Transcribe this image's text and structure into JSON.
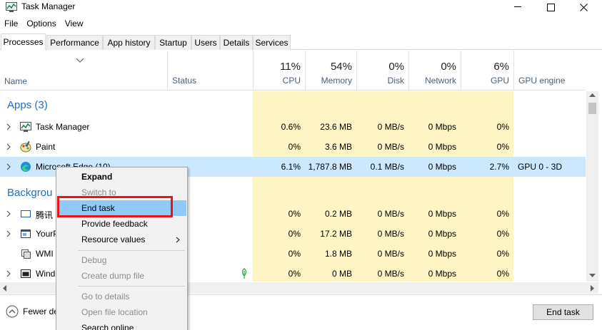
{
  "window": {
    "title": "Task Manager",
    "minimize": "—",
    "maximize": "☐",
    "close": "✕"
  },
  "menu": [
    "File",
    "Options",
    "View"
  ],
  "tabs": [
    "Processes",
    "Performance",
    "App history",
    "Startup",
    "Users",
    "Details",
    "Services"
  ],
  "header": {
    "name": "Name",
    "status": "Status",
    "cpu": {
      "pct": "11%",
      "label": "CPU"
    },
    "memory": {
      "pct": "54%",
      "label": "Memory"
    },
    "disk": {
      "pct": "0%",
      "label": "Disk"
    },
    "network": {
      "pct": "0%",
      "label": "Network"
    },
    "gpu": {
      "pct": "6%",
      "label": "GPU"
    },
    "gpu_engine": "GPU engine"
  },
  "groups": {
    "apps": "Apps (3)",
    "background": "Backgrou"
  },
  "rows": [
    {
      "name": "Task Manager",
      "cpu": "0.6%",
      "memory": "23.6 MB",
      "disk": "0 MB/s",
      "network": "0 Mbps",
      "gpu": "0%",
      "gpu_engine": ""
    },
    {
      "name": "Paint",
      "cpu": "0%",
      "memory": "3.6 MB",
      "disk": "0 MB/s",
      "network": "0 Mbps",
      "gpu": "0%",
      "gpu_engine": ""
    },
    {
      "name": "Microsoft Edge (10)",
      "cpu": "6.1%",
      "memory": "1,787.8 MB",
      "disk": "0.1 MB/s",
      "network": "0 Mbps",
      "gpu": "2.7%",
      "gpu_engine": "GPU 0 - 3D"
    },
    {
      "name": "腾讯",
      "cpu": "0%",
      "memory": "0.2 MB",
      "disk": "0 MB/s",
      "network": "0 Mbps",
      "gpu": "0%",
      "gpu_engine": ""
    },
    {
      "name": "YourP",
      "cpu": "0%",
      "memory": "17.2 MB",
      "disk": "0 MB/s",
      "network": "0 Mbps",
      "gpu": "0%",
      "gpu_engine": ""
    },
    {
      "name": "WMI",
      "cpu": "0%",
      "memory": "1.8 MB",
      "disk": "0 MB/s",
      "network": "0 Mbps",
      "gpu": "0%",
      "gpu_engine": ""
    },
    {
      "name": "Wind",
      "cpu": "0%",
      "memory": "0 MB",
      "disk": "0 MB/s",
      "network": "0 Mbps",
      "gpu": "0%",
      "gpu_engine": ""
    }
  ],
  "context_menu": {
    "expand": "Expand",
    "switch_to": "Switch to",
    "end_task": "End task",
    "provide_feedback": "Provide feedback",
    "resource_values": "Resource values",
    "debug": "Debug",
    "create_dump": "Create dump file",
    "go_to_details": "Go to details",
    "open_file_location": "Open file location",
    "search_online": "Search online"
  },
  "footer": {
    "fewer_details": "Fewer de",
    "end_task": "End task"
  },
  "colors": {
    "heat": "#fff4c4",
    "selected": "#cce8ff",
    "highlight": "#91c9f7",
    "annotation": "#e8141b",
    "group": "#1f6fc4"
  }
}
